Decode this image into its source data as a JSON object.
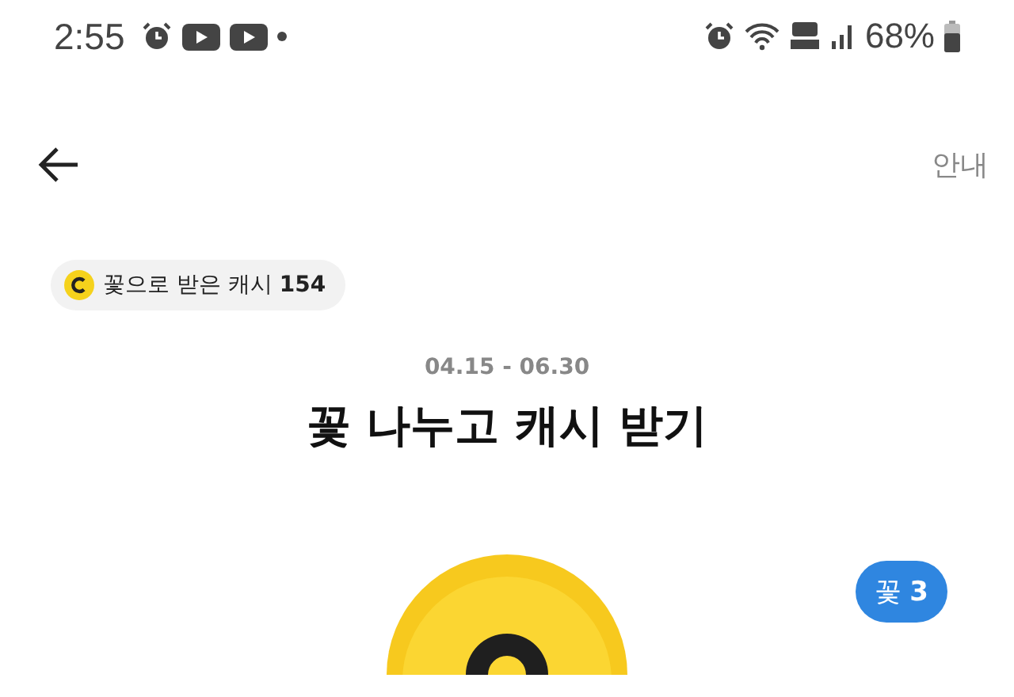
{
  "status_bar": {
    "time": "2:55",
    "battery": "68%"
  },
  "header": {
    "help_link": "안내"
  },
  "cash_chip": {
    "label": "꽃으로 받은 캐시 **154**"
  },
  "event": {
    "period": "04.15 - 06.30",
    "title": "꽃 나누고 캐시 받기"
  },
  "flower_badge": {
    "label": "꽃 **3**"
  }
}
